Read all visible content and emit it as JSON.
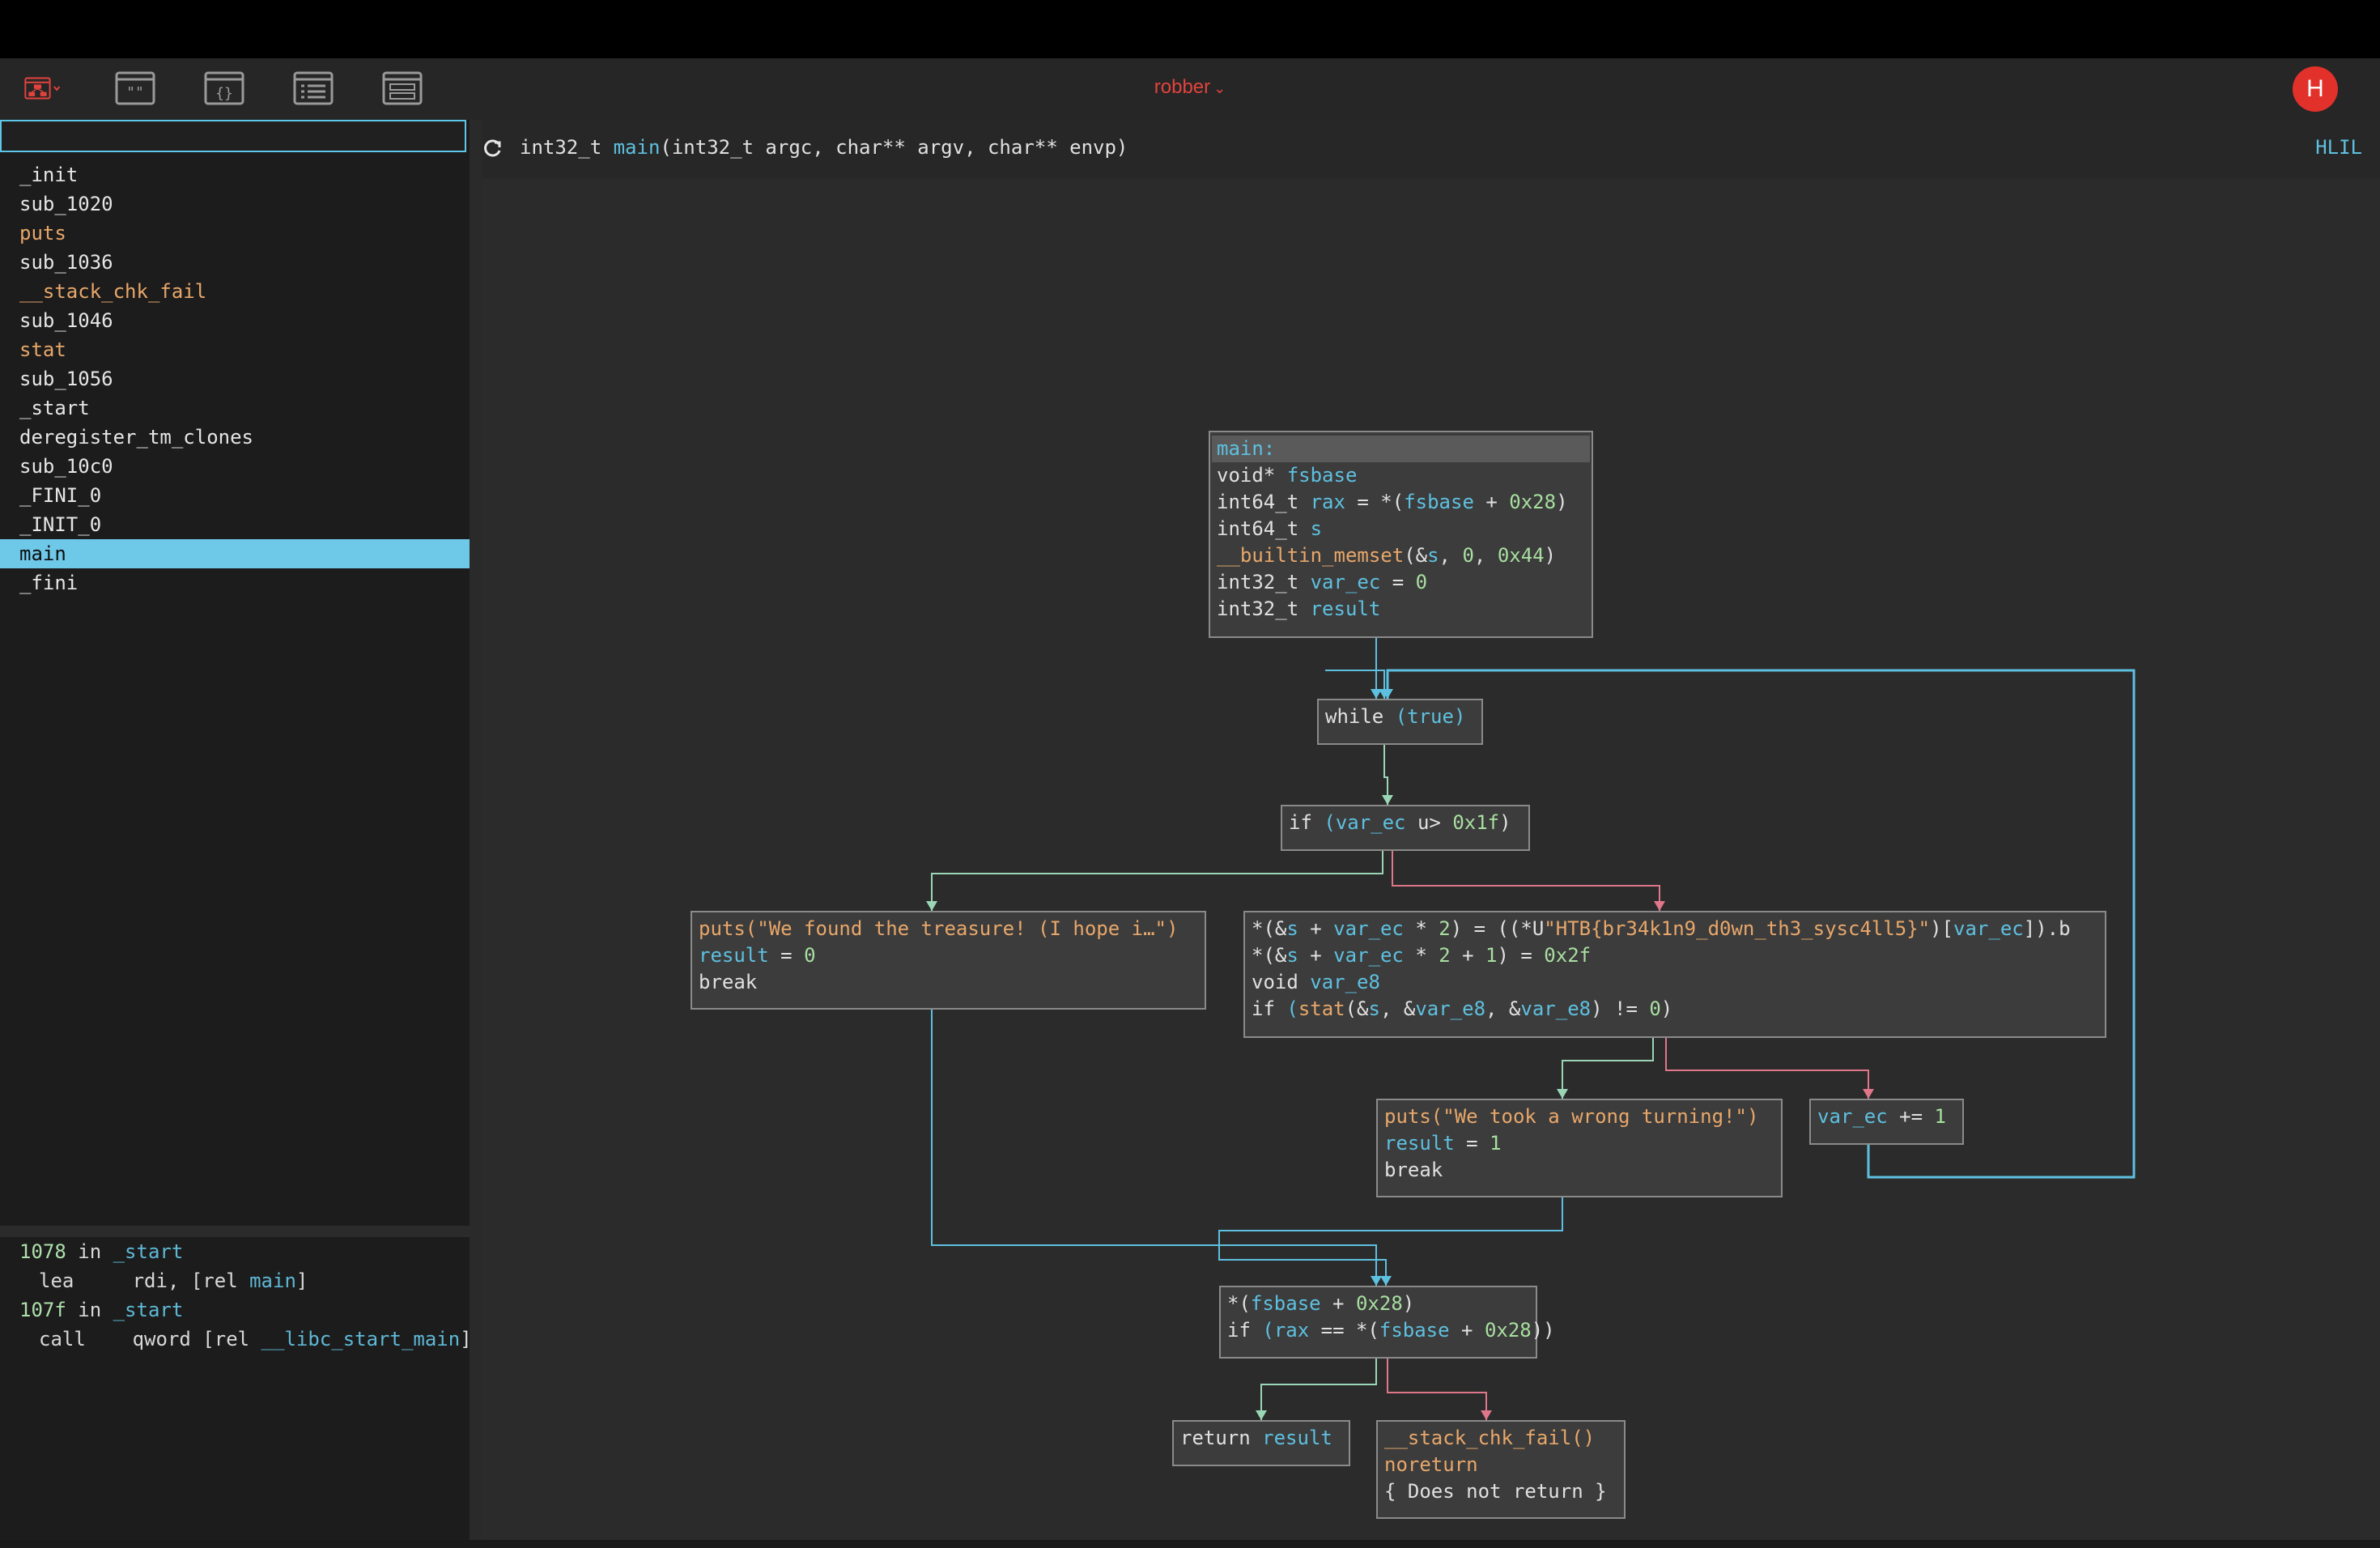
{
  "app": {
    "binary_name": "robber",
    "avatar_letter": "H"
  },
  "toolbar": {
    "buttons": [
      {
        "icon": "graph-view-icon",
        "active": true
      },
      {
        "icon": "strings-view-icon"
      },
      {
        "icon": "code-view-icon"
      },
      {
        "icon": "linear-view-icon"
      },
      {
        "icon": "types-view-icon"
      }
    ],
    "accent_color": "#e2433d"
  },
  "sidebar": {
    "search_value": "",
    "functions": [
      {
        "name": "_init",
        "kind": "normal"
      },
      {
        "name": "sub_1020",
        "kind": "normal"
      },
      {
        "name": "puts",
        "kind": "import"
      },
      {
        "name": "sub_1036",
        "kind": "normal"
      },
      {
        "name": "__stack_chk_fail",
        "kind": "import"
      },
      {
        "name": "sub_1046",
        "kind": "normal"
      },
      {
        "name": "stat",
        "kind": "import"
      },
      {
        "name": "sub_1056",
        "kind": "normal"
      },
      {
        "name": "_start",
        "kind": "normal"
      },
      {
        "name": "deregister_tm_clones",
        "kind": "normal"
      },
      {
        "name": "sub_10c0",
        "kind": "normal"
      },
      {
        "name": "_FINI_0",
        "kind": "normal"
      },
      {
        "name": "_INIT_0",
        "kind": "normal"
      },
      {
        "name": "main",
        "kind": "selected"
      },
      {
        "name": "_fini",
        "kind": "normal"
      }
    ],
    "xrefs": [
      {
        "addr": "1078",
        "in": "in",
        "func": "_start",
        "mnemonic": "lea",
        "op_a": "rdi, [rel ",
        "op_sym": "main",
        "op_b": "]"
      },
      {
        "addr": "107f",
        "in": "in",
        "func": "_start",
        "mnemonic": "call",
        "op_a": "qword [rel ",
        "op_sym": "__libc_start_main",
        "op_b": "]"
      }
    ]
  },
  "header": {
    "ret_type": "int32_t ",
    "func_name": "main",
    "params": "(int32_t argc, char** argv, char** envp)",
    "view_mode": "HLIL"
  },
  "graph": {
    "blocks": {
      "entry": {
        "lines": [
          [
            {
              "t": "main:",
              "c": "lbl"
            }
          ],
          [
            {
              "t": "void* "
            },
            {
              "t": "fsbase",
              "c": "var"
            }
          ],
          [
            {
              "t": "int64_t "
            },
            {
              "t": "rax",
              "c": "var"
            },
            {
              "t": " = *("
            },
            {
              "t": "fsbase",
              "c": "var"
            },
            {
              "t": " + "
            },
            {
              "t": "0x28",
              "c": "num"
            },
            {
              "t": ")"
            }
          ],
          [
            {
              "t": "int64_t "
            },
            {
              "t": "s",
              "c": "var"
            }
          ],
          [
            {
              "t": "__builtin_memset",
              "c": "fn"
            },
            {
              "t": "(&"
            },
            {
              "t": "s",
              "c": "var"
            },
            {
              "t": ", "
            },
            {
              "t": "0",
              "c": "num"
            },
            {
              "t": ", "
            },
            {
              "t": "0x44",
              "c": "num"
            },
            {
              "t": ")"
            }
          ],
          [
            {
              "t": "int32_t "
            },
            {
              "t": "var_ec",
              "c": "var"
            },
            {
              "t": " = "
            },
            {
              "t": "0",
              "c": "num"
            }
          ],
          [
            {
              "t": "int32_t "
            },
            {
              "t": "result",
              "c": "var"
            }
          ]
        ]
      },
      "loop": {
        "lines": [
          [
            {
              "t": "while "
            },
            {
              "t": "(true)",
              "c": "var"
            }
          ]
        ]
      },
      "cond": {
        "lines": [
          [
            {
              "t": "if "
            },
            {
              "t": "(",
              "c": "var"
            },
            {
              "t": "var_ec",
              "c": "var"
            },
            {
              "t": " u> "
            },
            {
              "t": "0x1f",
              "c": "num"
            },
            {
              "t": ")"
            }
          ]
        ]
      },
      "found": {
        "lines": [
          [
            {
              "t": "puts(",
              "c": "fn"
            },
            {
              "t": "\"We found the treasure! (I hope i…\"",
              "c": "str"
            },
            {
              "t": ")",
              "c": "fn"
            }
          ],
          [
            {
              "t": "result",
              "c": "var"
            },
            {
              "t": " = "
            },
            {
              "t": "0",
              "c": "num"
            }
          ],
          [
            {
              "t": "break"
            }
          ]
        ]
      },
      "body": {
        "lines": [
          [
            {
              "t": "*(&"
            },
            {
              "t": "s",
              "c": "var"
            },
            {
              "t": " + "
            },
            {
              "t": "var_ec",
              "c": "var"
            },
            {
              "t": " * "
            },
            {
              "t": "2",
              "c": "num"
            },
            {
              "t": ") = ((*U"
            },
            {
              "t": "\"HTB{br34k1n9_d0wn_th3_sysc4ll5}\"",
              "c": "str"
            },
            {
              "t": ")["
            },
            {
              "t": "var_ec",
              "c": "var"
            },
            {
              "t": "]).b"
            }
          ],
          [
            {
              "t": "*(&"
            },
            {
              "t": "s",
              "c": "var"
            },
            {
              "t": " + "
            },
            {
              "t": "var_ec",
              "c": "var"
            },
            {
              "t": " * "
            },
            {
              "t": "2",
              "c": "num"
            },
            {
              "t": " + "
            },
            {
              "t": "1",
              "c": "num"
            },
            {
              "t": ") = "
            },
            {
              "t": "0x2f",
              "c": "num"
            }
          ],
          [
            {
              "t": "void "
            },
            {
              "t": "var_e8",
              "c": "var"
            }
          ],
          [
            {
              "t": "if "
            },
            {
              "t": "(",
              "c": "var"
            },
            {
              "t": "stat",
              "c": "fn"
            },
            {
              "t": "(&"
            },
            {
              "t": "s",
              "c": "var"
            },
            {
              "t": ", &"
            },
            {
              "t": "var_e8",
              "c": "var"
            },
            {
              "t": ", &"
            },
            {
              "t": "var_e8",
              "c": "var"
            },
            {
              "t": ") != "
            },
            {
              "t": "0",
              "c": "num"
            },
            {
              "t": ")"
            }
          ]
        ]
      },
      "wrong": {
        "lines": [
          [
            {
              "t": "puts(",
              "c": "fn"
            },
            {
              "t": "\"We took a wrong turning!\"",
              "c": "str"
            },
            {
              "t": ")",
              "c": "fn"
            }
          ],
          [
            {
              "t": "result",
              "c": "var"
            },
            {
              "t": " = "
            },
            {
              "t": "1",
              "c": "num"
            }
          ],
          [
            {
              "t": "break"
            }
          ]
        ]
      },
      "incr": {
        "lines": [
          [
            {
              "t": "var_ec",
              "c": "var"
            },
            {
              "t": " += "
            },
            {
              "t": "1",
              "c": "num"
            }
          ]
        ]
      },
      "check": {
        "lines": [
          [
            {
              "t": "*("
            },
            {
              "t": "fsbase",
              "c": "var"
            },
            {
              "t": " + "
            },
            {
              "t": "0x28",
              "c": "num"
            },
            {
              "t": ")"
            }
          ],
          [
            {
              "t": "if "
            },
            {
              "t": "(",
              "c": "var"
            },
            {
              "t": "rax",
              "c": "var"
            },
            {
              "t": " == *("
            },
            {
              "t": "fsbase",
              "c": "var"
            },
            {
              "t": " + "
            },
            {
              "t": "0x28",
              "c": "num"
            },
            {
              "t": "))"
            }
          ]
        ]
      },
      "ret": {
        "lines": [
          [
            {
              "t": "return "
            },
            {
              "t": "result",
              "c": "var"
            }
          ]
        ]
      },
      "fail": {
        "lines": [
          [
            {
              "t": "__stack_chk_fail()",
              "c": "fn"
            }
          ],
          [
            {
              "t": "noreturn",
              "c": "fn"
            }
          ],
          [
            {
              "t": "{ Does not return }"
            }
          ]
        ]
      }
    },
    "edge_colors": {
      "true": "#9ad6b6",
      "false": "#e0768a",
      "unconditional": "#5ec0e0",
      "loop": "#5ec0e0"
    }
  }
}
